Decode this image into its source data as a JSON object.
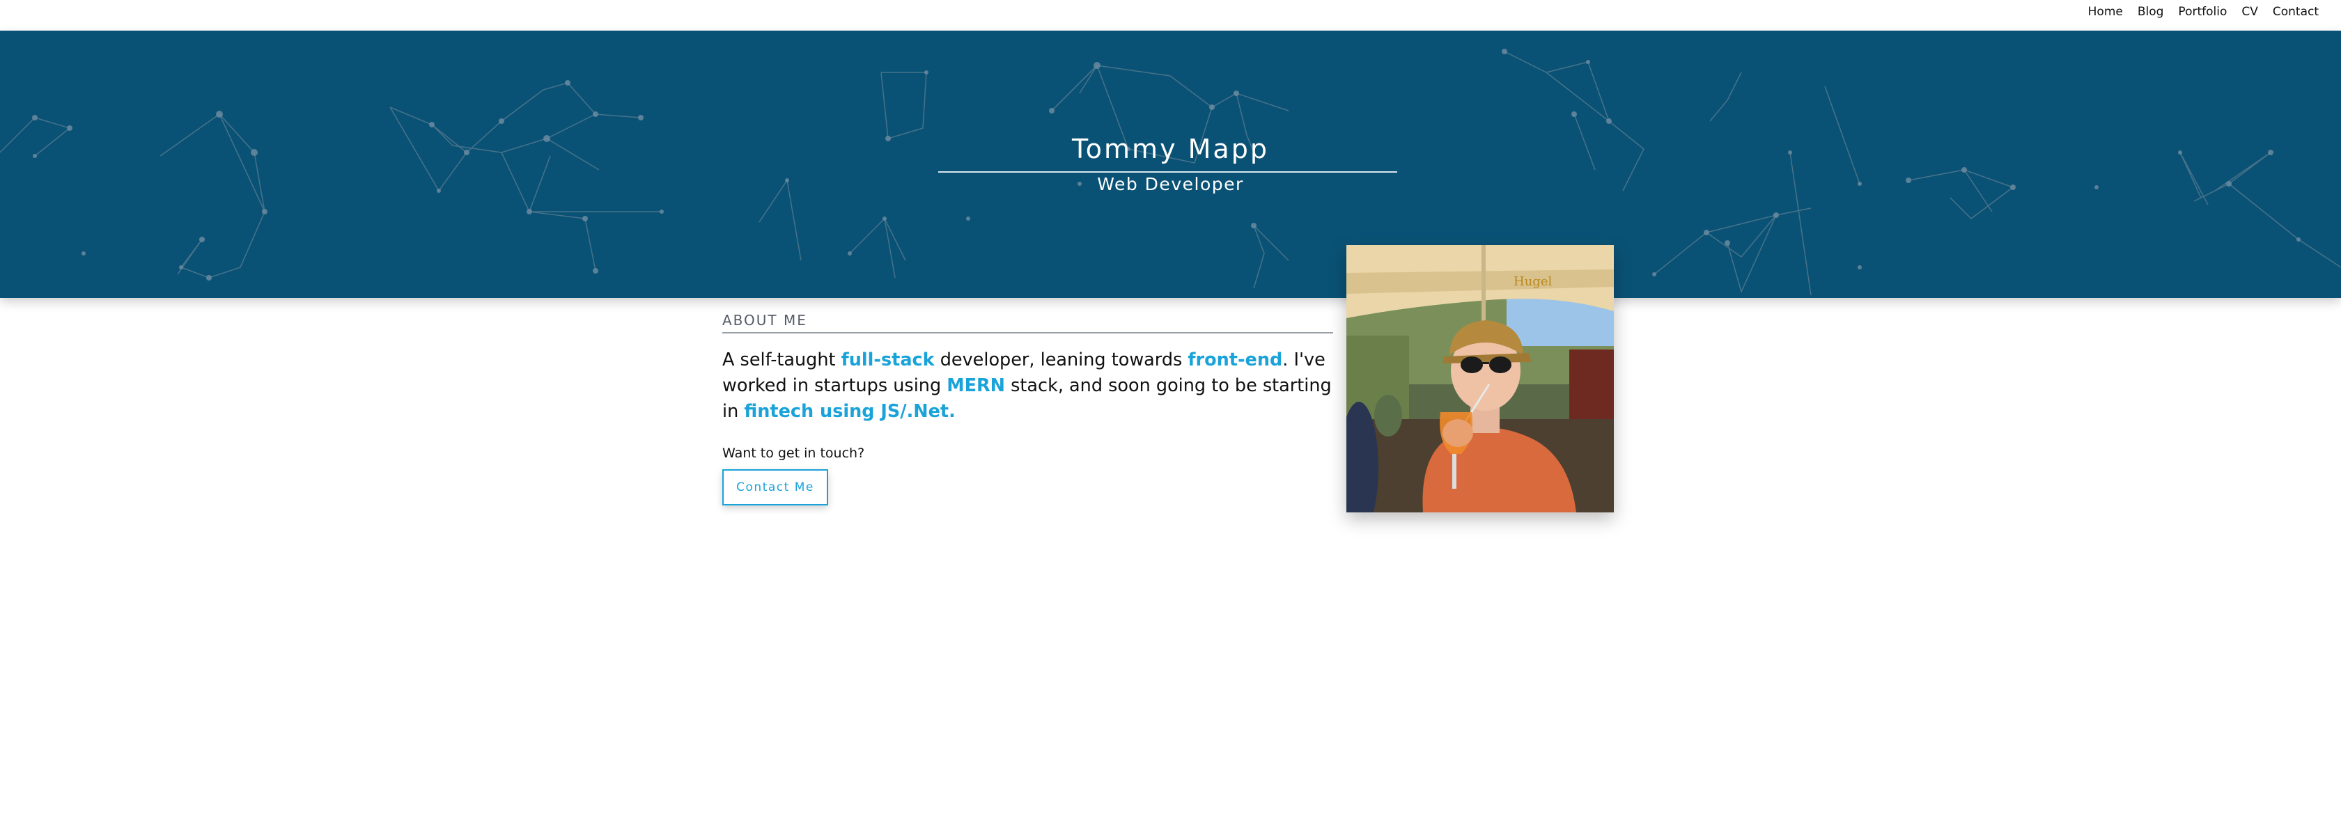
{
  "nav": {
    "items": [
      {
        "label": "Home"
      },
      {
        "label": "Blog"
      },
      {
        "label": "Portfolio"
      },
      {
        "label": "CV"
      },
      {
        "label": "Contact"
      }
    ]
  },
  "hero": {
    "name": "Tommy Mapp",
    "title": "Web Developer"
  },
  "about": {
    "heading": "ABOUT ME",
    "segments": [
      {
        "text": "A self-taught ",
        "highlight": false
      },
      {
        "text": "full-stack",
        "highlight": true
      },
      {
        "text": " developer, leaning towards ",
        "highlight": false
      },
      {
        "text": "front-end",
        "highlight": true
      },
      {
        "text": ". I've worked in startups using ",
        "highlight": false
      },
      {
        "text": "MERN",
        "highlight": true
      },
      {
        "text": " stack, and soon going to be starting in ",
        "highlight": false
      },
      {
        "text": "fintech using JS/.Net.",
        "highlight": true
      }
    ],
    "touch_prompt": "Want to get in touch?",
    "contact_button": "Contact Me"
  },
  "colors": {
    "hero_bg": "#0a5275",
    "accent": "#1aa3d9",
    "network_lines": "#5b7d92"
  },
  "icons": {
    "profile_photo": "person-drinking-photo"
  }
}
